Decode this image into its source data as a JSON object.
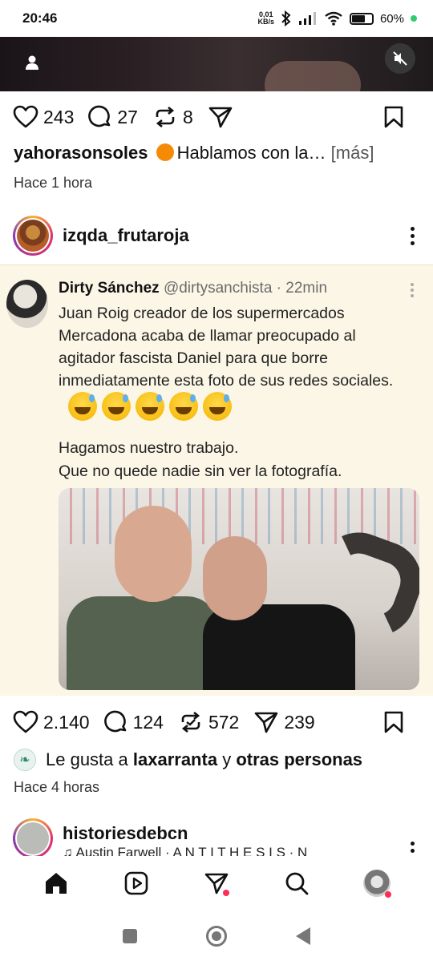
{
  "status_bar": {
    "time": "20:46",
    "net_speed_value": "0,01",
    "net_speed_unit": "KB/s",
    "battery": "60%",
    "battery_level_percent": 60,
    "icons": [
      "bluetooth-icon",
      "signal-icon",
      "wifi-icon",
      "battery-icon"
    ]
  },
  "post1": {
    "actions": {
      "likes": "243",
      "comments": "27",
      "reposts": "8"
    },
    "caption_user": "yahorasonsoles",
    "caption_text": "Hablamos con la…",
    "caption_more": "[más]",
    "time": "Hace 1 hora"
  },
  "post2": {
    "username": "izqda_frutaroja",
    "tweet": {
      "name": "Dirty Sánchez",
      "handle": "@dirtysanchista · 22min",
      "text": "Juan Roig creador de los supermercados Mercadona acaba de llamar preocupado al agitador fascista Daniel para que borre inmediatamente esta foto de sus redes sociales.",
      "line2": "Hagamos nuestro trabajo.",
      "line3": "Que no quede nadie sin ver la fotografía."
    },
    "actions": {
      "likes": "2.140",
      "comments": "124",
      "reposts": "572",
      "shares": "239"
    },
    "liked_by_prefix": "Le gusta a",
    "liked_by_user": "laxarranta",
    "liked_by_join": "y",
    "liked_by_others": "otras personas",
    "time": "Hace 4 horas"
  },
  "post3": {
    "username": "historiesdebcn",
    "music": "Austin Farwell · A N T I T H E S I S · N"
  },
  "bottom_nav": [
    "home-icon",
    "reels-icon",
    "messages-icon",
    "search-icon",
    "profile-avatar"
  ]
}
